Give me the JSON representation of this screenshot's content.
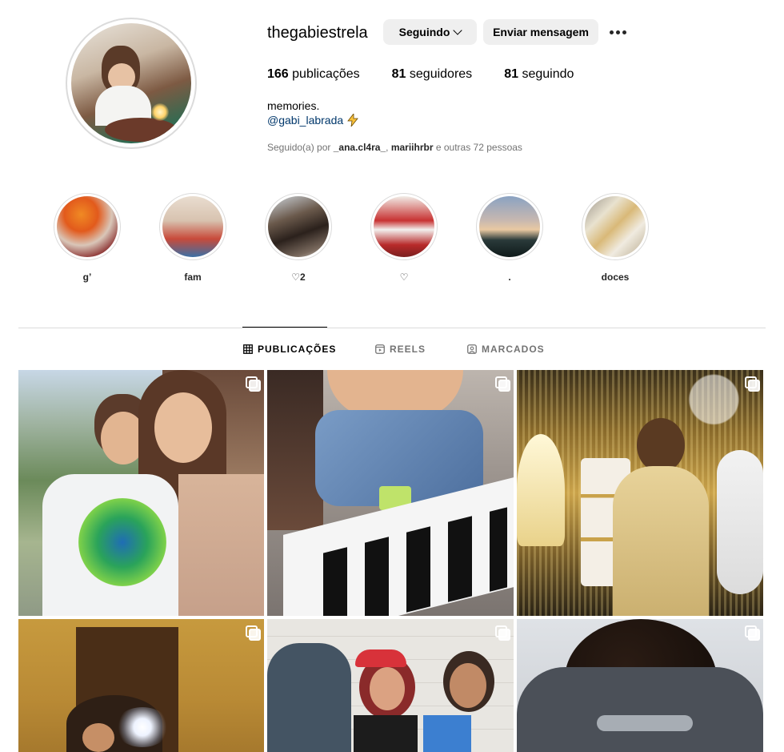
{
  "profile": {
    "username": "thegabiestrela",
    "following_button": "Seguindo",
    "message_button": "Enviar mensagem",
    "stats": {
      "posts_count": "166",
      "posts_label": "publicações",
      "followers_count": "81",
      "followers_label": "seguidores",
      "following_count": "81",
      "following_label": "seguindo"
    },
    "bio": {
      "name_line": "memories.",
      "link": "@gabi_labrada"
    },
    "followed_by": {
      "prefix": "Seguido(a) por",
      "user1": "_ana.cl4ra_",
      "sep": ",",
      "user2": "mariihrbr",
      "suffix": "e outras 72 pessoas"
    }
  },
  "highlights": [
    {
      "label": "g’"
    },
    {
      "label": "fam"
    },
    {
      "label": "♡2"
    },
    {
      "label": "♡"
    },
    {
      "label": "."
    },
    {
      "label": "doces"
    }
  ],
  "tabs": {
    "posts": "PUBLICAÇÕES",
    "reels": "REELS",
    "tagged": "MARCADOS"
  },
  "colors": {
    "link": "#00376b",
    "muted": "#737373",
    "button_bg": "#efefef",
    "divider": "#dbdbdb"
  }
}
